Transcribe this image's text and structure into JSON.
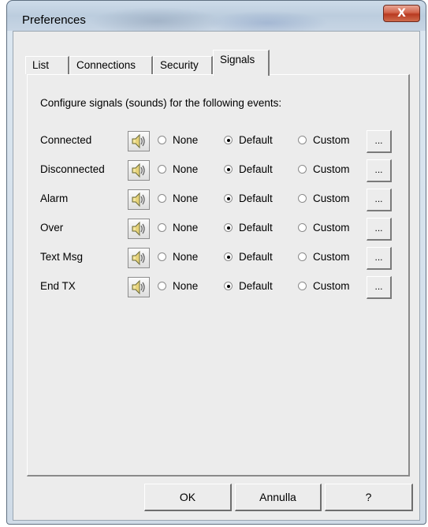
{
  "window": {
    "title": "Preferences",
    "close_label": "X"
  },
  "tabs": [
    {
      "label": "List",
      "active": false
    },
    {
      "label": "Connections",
      "active": false
    },
    {
      "label": "Security",
      "active": false
    },
    {
      "label": "Signals",
      "active": true
    }
  ],
  "signals": {
    "intro": "Configure signals (sounds) for the following events:",
    "option_labels": {
      "none": "None",
      "default": "Default",
      "custom": "Custom"
    },
    "browse_label": "...",
    "events": [
      {
        "label": "Connected",
        "selected": "default",
        "icon": "speaker-icon"
      },
      {
        "label": "Disconnected",
        "selected": "default",
        "icon": "speaker-icon"
      },
      {
        "label": "Alarm",
        "selected": "default",
        "icon": "speaker-icon"
      },
      {
        "label": "Over",
        "selected": "default",
        "icon": "speaker-icon"
      },
      {
        "label": "Text Msg",
        "selected": "default",
        "icon": "speaker-icon"
      },
      {
        "label": "End TX",
        "selected": "default",
        "icon": "speaker-icon"
      }
    ]
  },
  "buttons": {
    "ok": "OK",
    "cancel": "Annulla",
    "help": "?"
  }
}
